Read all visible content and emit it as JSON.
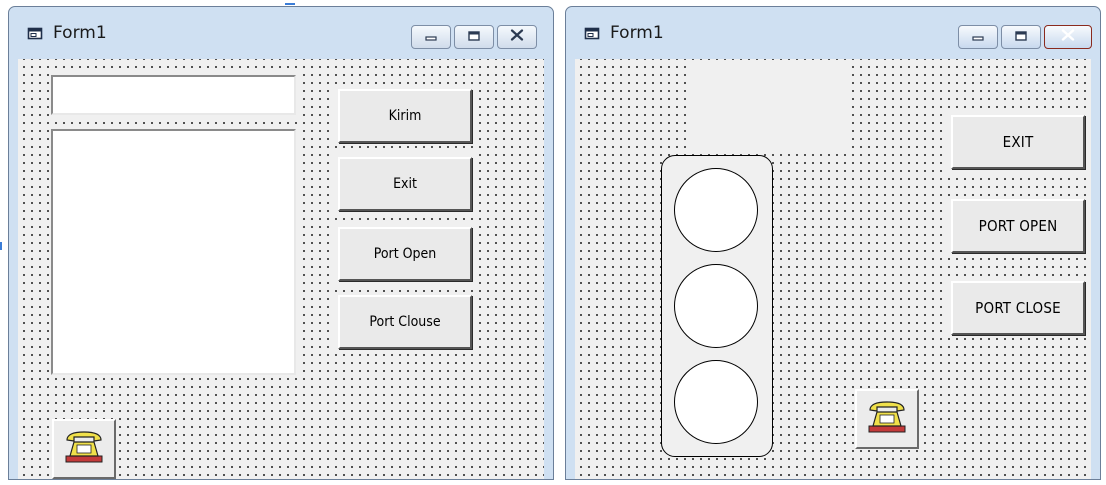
{
  "window_left": {
    "title": "Form1",
    "text_input": {
      "value": ""
    },
    "list_box": {
      "items": []
    },
    "buttons": {
      "kirim": "Kirim",
      "exit": "Exit",
      "port_open": "Port Open",
      "port_close": "Port Clouse"
    },
    "phone_icon": "telephone-icon"
  },
  "window_right": {
    "title": "Form1",
    "buttons": {
      "exit": "EXIT",
      "port_open": "PORT OPEN",
      "port_close": "PORT CLOSE"
    },
    "traffic_light": {
      "lamps": [
        "off",
        "off",
        "off"
      ]
    },
    "phone_icon": "telephone-icon"
  },
  "colors": {
    "frame": "#cfe0f2",
    "client_bg": "#f0f0f0",
    "close_button_red": "#c9412a"
  }
}
